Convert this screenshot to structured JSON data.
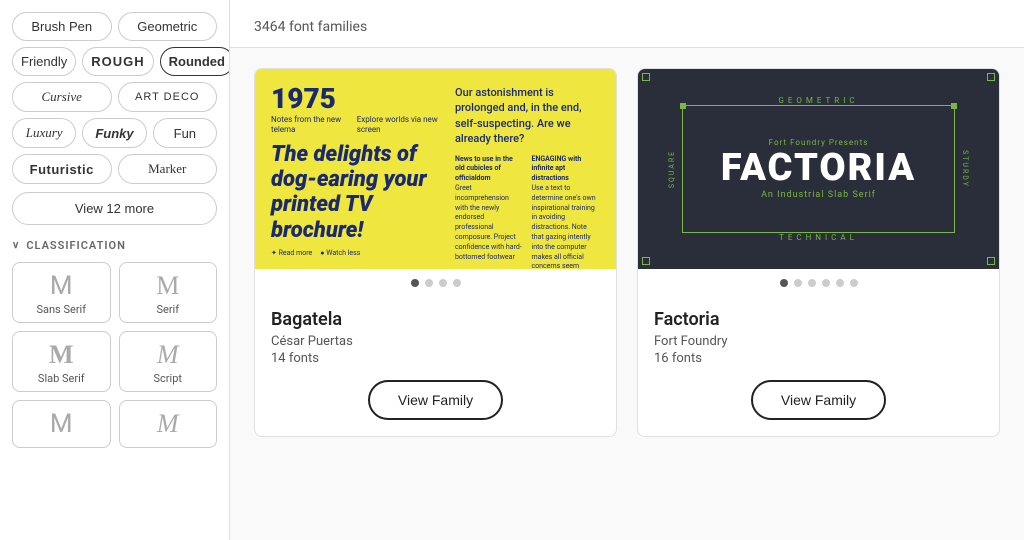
{
  "sidebar": {
    "top_tags_row1": [
      {
        "label": "Brush Pen",
        "style": ""
      },
      {
        "label": "Geometric",
        "style": ""
      }
    ],
    "top_tags_row2": [
      {
        "label": "Friendly",
        "style": ""
      },
      {
        "label": "ROUGH",
        "style": "rough"
      },
      {
        "label": "Rounded",
        "style": "rounded active"
      }
    ],
    "top_tags_row3": [
      {
        "label": "Cursive",
        "style": "cursive-style"
      },
      {
        "label": "ART DECO",
        "style": "art-deco-style"
      }
    ],
    "top_tags_row4": [
      {
        "label": "Luxury",
        "style": "luxury-style"
      },
      {
        "label": "Funky",
        "style": "funky-style"
      },
      {
        "label": "Fun",
        "style": ""
      }
    ],
    "top_tags_row5": [
      {
        "label": "Futuristic",
        "style": "futuristic-style"
      },
      {
        "label": "Marker",
        "style": "marker-style"
      }
    ],
    "view_more_label": "View 12 more",
    "classification_header": "CLASSIFICATION",
    "classification_items": [
      {
        "letter": "M",
        "label": "Sans Serif",
        "style": ""
      },
      {
        "letter": "M",
        "label": "Serif",
        "style": "serif-style"
      },
      {
        "letter": "M",
        "label": "Slab Serif",
        "style": "slab-serif-style"
      },
      {
        "letter": "M",
        "label": "Script",
        "style": "script-style"
      }
    ],
    "extra_items": [
      {
        "letter": "M",
        "label": "",
        "style": ""
      },
      {
        "letter": "M",
        "label": "",
        "style": "script-style"
      }
    ]
  },
  "main": {
    "font_count": "3464 font families",
    "cards": [
      {
        "id": "bagatela",
        "preview_type": "bagatela",
        "year": "1975",
        "note1": "Notes from the new telema",
        "note2": "Explore worlds via new screen",
        "main_text": "The delights of dog-earing your printed TV brochure!",
        "quote": "Our astonishment is prolonged and, in the end, self-suspecting. Are we already there?",
        "col1_label": "News to use in the old cubicles of officialdom",
        "col1_text": "Greet incomprehension with the newly endorsed professional composure. Project confidence with hard-bottomed footwear",
        "col2_label": "ENGAGING with infinite apt distractions",
        "col2_text": "Use a text to determine one's own inspirational training in avoiding distractions. Note that gazing intently into the computer makes all official concerns seem downright formidable.",
        "read_more": "✦ Read more",
        "watch_less": "● Watch less",
        "dots": [
          true,
          false,
          false,
          false
        ],
        "font_name": "Bagatela",
        "designer": "César Puertas",
        "num_fonts": "14 fonts",
        "view_family_label": "View Family"
      },
      {
        "id": "factoria",
        "preview_type": "factoria",
        "geometric_label": "GEOMETRIC",
        "foundry_label": "Fort Foundry Presents",
        "main_name": "FACTORIA",
        "sub_label": "An Industrial Slab Serif",
        "square_label": "SQUARE",
        "sturdy_label": "STURDY",
        "technical_label": "TECHNICAL",
        "dots": [
          true,
          false,
          false,
          false,
          false,
          false
        ],
        "font_name": "Factoria",
        "designer": "Fort Foundry",
        "num_fonts": "16 fonts",
        "view_family_label": "View Family"
      }
    ]
  }
}
